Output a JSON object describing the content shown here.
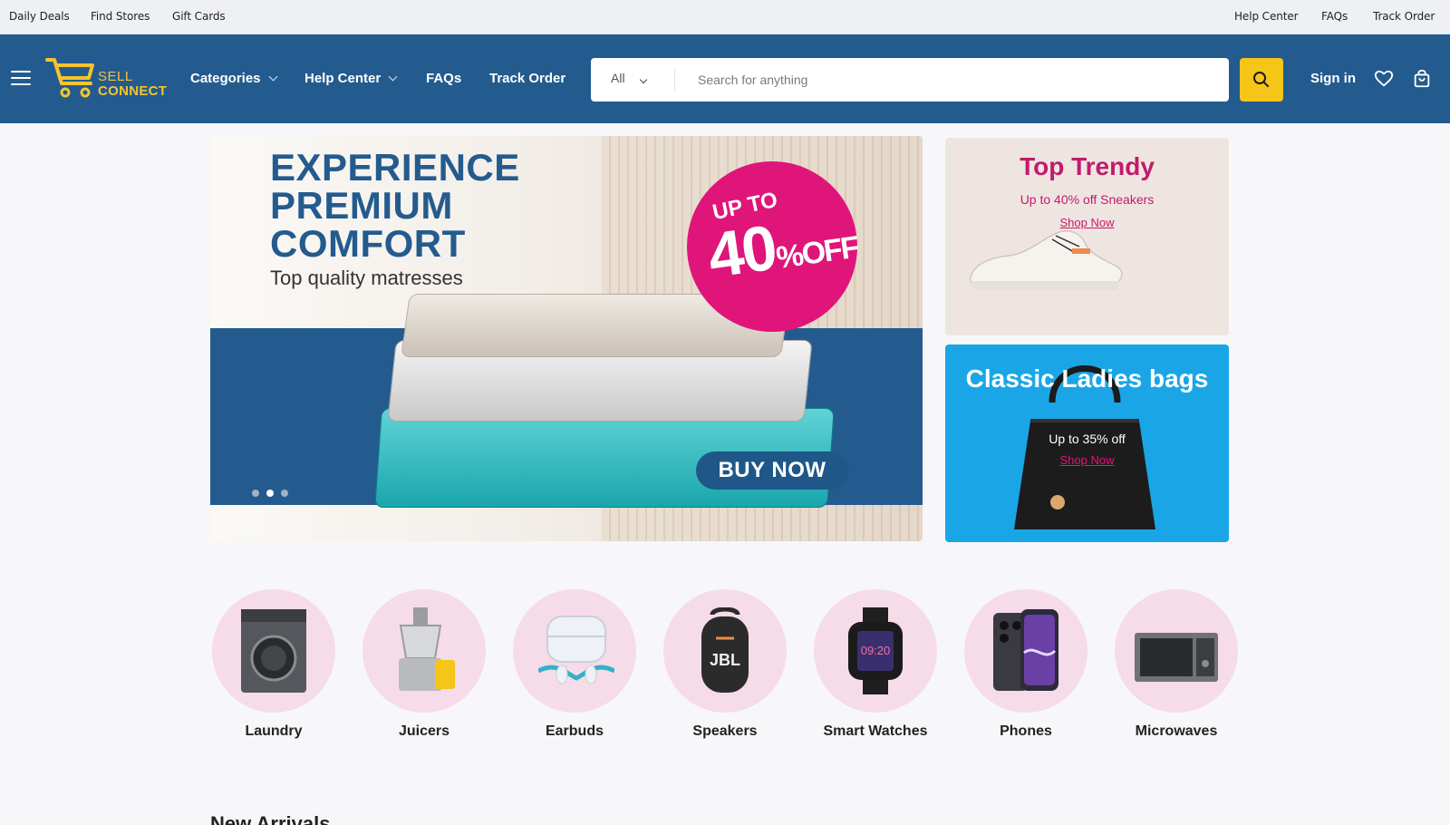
{
  "utility_bar": {
    "left_links": [
      "Daily Deals",
      "Find Stores",
      "Gift Cards"
    ],
    "right_links": [
      "Help Center",
      "FAQs",
      "Track Order"
    ]
  },
  "header": {
    "logo": {
      "line1": "SELL",
      "line2": "CONNECT"
    },
    "nav": [
      {
        "label": "Categories",
        "dropdown": true
      },
      {
        "label": "Help Center",
        "dropdown": true
      },
      {
        "label": "FAQs",
        "dropdown": false
      },
      {
        "label": "Track Order",
        "dropdown": false
      }
    ],
    "search": {
      "category": "All",
      "placeholder": "Search for anything"
    },
    "sign_in": "Sign in",
    "colors": {
      "header_bg": "#245b8e",
      "accent": "#f5c518"
    }
  },
  "hero": {
    "headline_lines": [
      "EXPERIENCE",
      "PREMIUM",
      "COMFORT"
    ],
    "subtitle": "Top quality matresses",
    "badge": {
      "top": "UP TO",
      "value": "40",
      "suffix": "%",
      "off": "OFF"
    },
    "cta": "BUY NOW",
    "slide_count": 3,
    "active_slide": 2
  },
  "side_banners": [
    {
      "title": "Top Trendy",
      "subtitle": "Up to 40% off Sneakers",
      "link": "Shop Now"
    },
    {
      "title": "Classic Ladies bags",
      "subtitle": "Up to 35% off",
      "link": "Shop Now"
    }
  ],
  "categories": [
    {
      "label": "Laundry",
      "icon": "washing-machine-icon"
    },
    {
      "label": "Juicers",
      "icon": "juicer-icon"
    },
    {
      "label": "Earbuds",
      "icon": "earbuds-icon"
    },
    {
      "label": "Speakers",
      "icon": "speaker-icon"
    },
    {
      "label": "Smart Watches",
      "icon": "smart-watch-icon"
    },
    {
      "label": "Phones",
      "icon": "phone-icon"
    },
    {
      "label": "Microwaves",
      "icon": "microwave-icon"
    }
  ],
  "next_section_title": "New Arrivals"
}
